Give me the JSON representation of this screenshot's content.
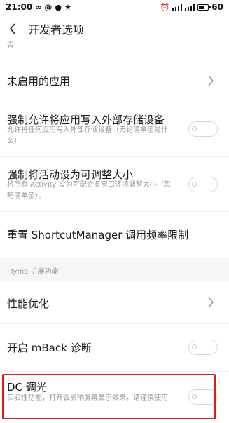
{
  "status_bar": {
    "time": "21:00",
    "battery": "60",
    "battery_level": 0.6,
    "left_icons": [
      "infinity-icon",
      "at-icon",
      "chat-icon",
      "person-icon"
    ],
    "right_icons": [
      "alarm-icon",
      "signal-icon",
      "signal-icon",
      "battery-icon"
    ]
  },
  "header": {
    "title": "开发者选项"
  },
  "cut_text": "否",
  "rows": [
    {
      "title": "未启用的应用",
      "control": "chevron"
    },
    {
      "title": "强制允许将应用写入外部存储设备",
      "subtitle": "允许将任何应用写入外部存储设备（无论清单值是什么）",
      "control": "toggle",
      "checked": false
    },
    {
      "title": "强制将活动设为可调整大小",
      "subtitle": "将所有 Activity 设为可配合多窗口环境调整大小（忽略清单值）。",
      "control": "toggle",
      "checked": false
    },
    {
      "title": "重置 ShortcutManager 调用频率限制",
      "control": "none"
    }
  ],
  "section": {
    "title": "Flyme 扩展功能"
  },
  "flyme_rows": [
    {
      "title": "性能优化",
      "control": "chevron"
    },
    {
      "title": "开启 mBack 诊断",
      "control": "toggle",
      "checked": false
    },
    {
      "title": "DC 调光",
      "subtitle": "实验性功能，打开会影响屏幕显示效果，请谨慎使用",
      "control": "toggle",
      "checked": false
    }
  ],
  "colors": {
    "highlight": "#e0191f",
    "section_bg": "#f6f6f6",
    "subtitle": "#9a9a9a"
  }
}
